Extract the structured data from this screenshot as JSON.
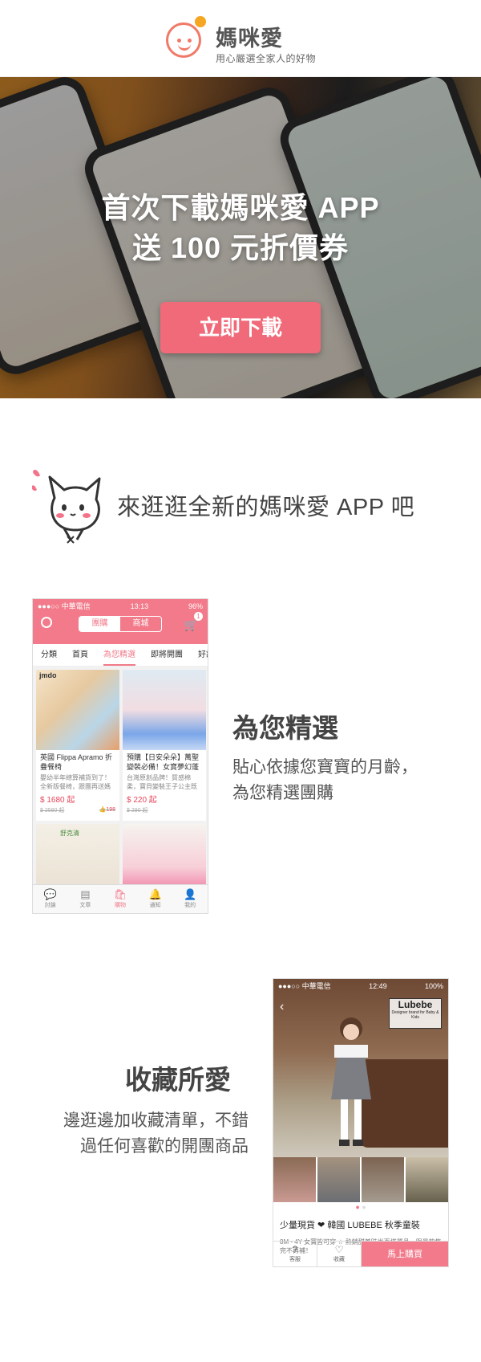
{
  "header": {
    "brand_name": "媽咪愛",
    "tagline": "用心嚴選全家人的好物"
  },
  "hero": {
    "line1": "首次下載媽咪愛 APP",
    "line2": "送 100 元折價券",
    "cta_label": "立即下載"
  },
  "intro": {
    "text": "來逛逛全新的媽咪愛 APP 吧"
  },
  "feature1": {
    "title": "為您精選",
    "desc_line1": "貼心依據您寶寶的月齡，",
    "desc_line2": "為您精選團購",
    "phone": {
      "carrier": "●●●○○ 中華電信",
      "time": "13:13",
      "battery": "96%",
      "segments": [
        "團購",
        "商城"
      ],
      "cart_count": "1",
      "tabs": [
        "分類",
        "首頁",
        "為您精選",
        "即將開團",
        "好評"
      ],
      "cards": [
        {
          "brand": "jmdo",
          "title": "英國 Flippa Apramo 折疊餐椅",
          "desc": "嬰幼半年總算補貨到了！全新版餐椅，跟團再送媽",
          "price": "$ 1680 起",
          "orig": "$ 2580 起",
          "likes": "198"
        },
        {
          "title": "預購【日安朵朵】萬聖變裝必備！女寶夢幻蓬",
          "desc": "台灣原創品牌！質感棉柔，寶貝變裝王子公主既",
          "price": "$ 220 起",
          "orig": "$ 290 起"
        }
      ],
      "card3_brand": "舒克清",
      "nav": [
        "討論",
        "文章",
        "購物",
        "通知",
        "我的"
      ]
    }
  },
  "feature2": {
    "title": "收藏所愛",
    "desc_line1": "邊逛邊加收藏清單，不錯",
    "desc_line2": "過任何喜歡的開團商品",
    "phone": {
      "carrier": "●●●○○ 中華電信",
      "time": "12:49",
      "battery": "100%",
      "brand_name": "Lubebe",
      "brand_sub": "Designer brand for Baby & Kids",
      "product_title": "少量現貨 ❤ 韓國 LUBEBE 秋季童裝",
      "product_desc": "8M - 4Y 女寶皆可穿 ☆ 熱銷甜美時尚百搭單品，限量款售完不再補！",
      "btn_service": "客服",
      "btn_fav": "收藏",
      "btn_buy": "馬上購買"
    }
  }
}
